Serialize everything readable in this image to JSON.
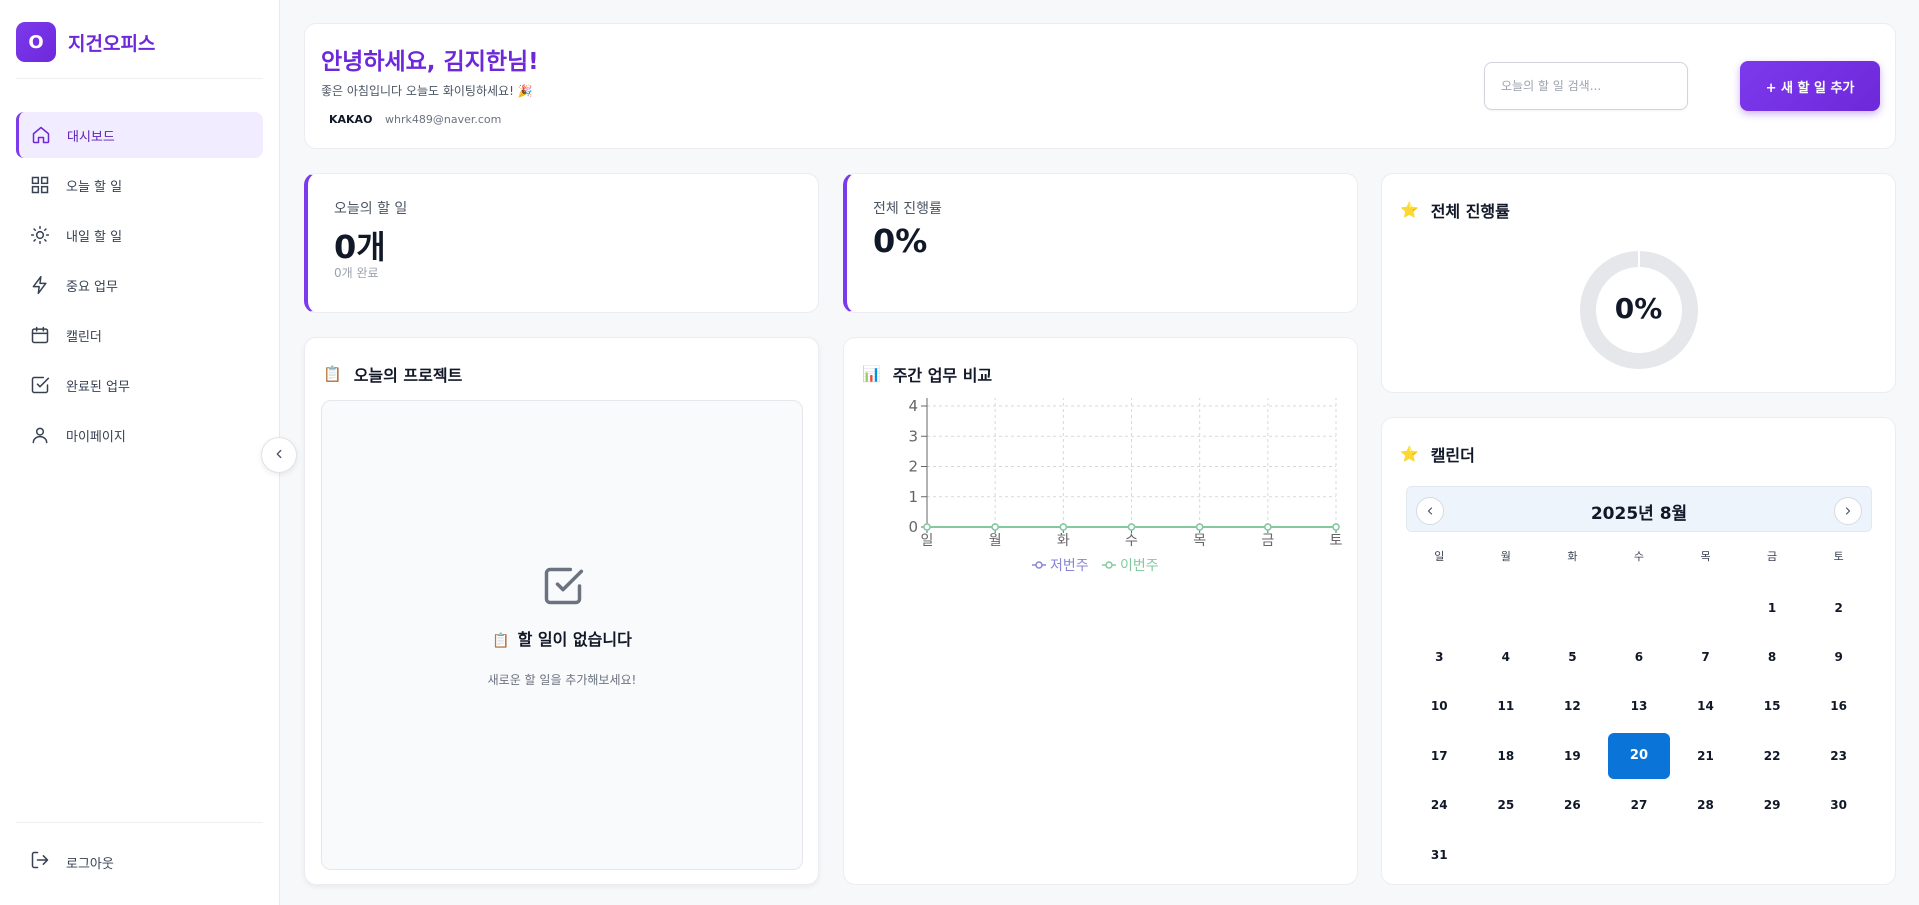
{
  "brand": {
    "logo_letter": "O",
    "name": "지건오피스"
  },
  "sidebar": {
    "items": [
      {
        "label": "대시보드",
        "icon": "home-icon",
        "active": true
      },
      {
        "label": "오늘 할 일",
        "icon": "grid-icon",
        "active": false
      },
      {
        "label": "내일 할 일",
        "icon": "sun-icon",
        "active": false
      },
      {
        "label": "중요 업무",
        "icon": "lightning-icon",
        "active": false
      },
      {
        "label": "캘린더",
        "icon": "calendar-icon",
        "active": false
      },
      {
        "label": "완료된 업무",
        "icon": "check-square-icon",
        "active": false
      },
      {
        "label": "마이페이지",
        "icon": "user-icon",
        "active": false
      }
    ],
    "logout_label": "로그아웃"
  },
  "header": {
    "greeting": "안녕하세요, 김지한님!",
    "subtitle": "좋은 아침입니다 오늘도 화이팅하세요! 🎉",
    "provider": "KAKAO",
    "email": "whrk489@naver.com",
    "search_placeholder": "오늘의 할 일 검색...",
    "add_button": "+ 새 할 일 추가"
  },
  "stats": {
    "today": {
      "label": "오늘의 할 일",
      "value": "0개",
      "sub": "0개 완료"
    },
    "progress": {
      "label": "전체 진행률",
      "value": "0%"
    }
  },
  "projects": {
    "title_emoji": "📋",
    "title": "오늘의 프로젝트",
    "empty_emoji": "📋",
    "empty_title": "할 일이 없습니다",
    "empty_sub": "새로운 할 일을 추가해보세요!"
  },
  "weekly": {
    "title_emoji": "📊",
    "title": "주간 업무 비교"
  },
  "progress_ring": {
    "title_emoji": "⭐",
    "title": "전체 진행률",
    "value": "0%",
    "fraction": 0,
    "track_color": "#e5e7eb",
    "fill_color": "#7c3aed"
  },
  "calendar": {
    "title_emoji": "⭐",
    "title": "캘린더",
    "month_label": "2025년 8월",
    "weekdays": [
      "일",
      "월",
      "화",
      "수",
      "목",
      "금",
      "토"
    ],
    "first_weekday_index": 5,
    "days_in_month": 31,
    "selected_day": 20,
    "selected_color": "#0a74d8"
  },
  "chart_data": {
    "type": "line",
    "categories": [
      "일",
      "월",
      "화",
      "수",
      "목",
      "금",
      "토"
    ],
    "series": [
      {
        "name": "저번주",
        "values": [
          0,
          0,
          0,
          0,
          0,
          0,
          0
        ],
        "color": "#8884d8"
      },
      {
        "name": "이번주",
        "values": [
          0,
          0,
          0,
          0,
          0,
          0,
          0
        ],
        "color": "#82ca9d"
      }
    ],
    "yticks": [
      0,
      1,
      2,
      3,
      4
    ],
    "ylim": [
      0,
      4
    ],
    "grid": true,
    "legend": "bottom",
    "title": "",
    "xlabel": "",
    "ylabel": ""
  }
}
